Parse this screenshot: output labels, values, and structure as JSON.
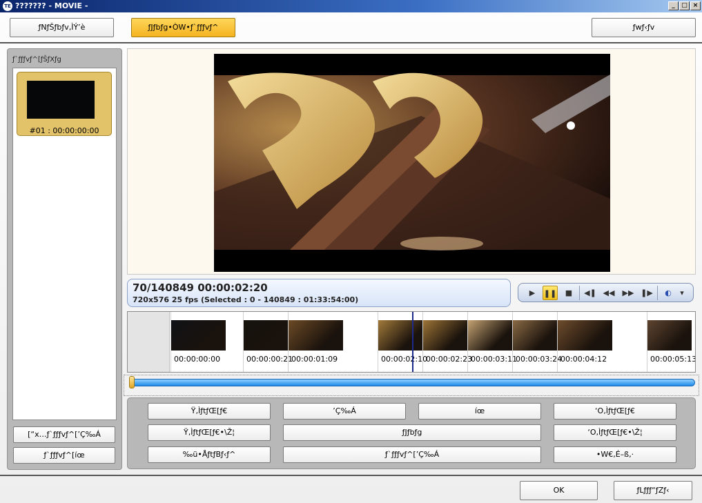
{
  "window": {
    "title": "??????? - MOVIE -",
    "min_label": "_",
    "max_label": "□",
    "close_label": "×"
  },
  "toolbar": {
    "left_button": "ƒNƒŠƒbƒv‚ÌÝ’è",
    "middle_button": "ƒJƒbƒg•ÒW•ƒ`ƒƒƒvƒ^",
    "right_button": "ƒwƒ‹ƒv"
  },
  "chapter_panel": {
    "label": "ƒ`ƒƒƒvƒ^[ƒŠƒXƒg",
    "items": [
      {
        "label": "#01 : 00:00:00:00"
      }
    ],
    "add_button": "[“x…ƒ`ƒƒƒvƒ^[’Ç‰Á",
    "delete_button": "ƒ`ƒƒƒvƒ^[íœ"
  },
  "player": {
    "position_text": "70/140849  00:00:02:20",
    "detail_text": "720x576 25 fps  (Selected : 0 - 140849 : 01:33:54:00)",
    "progress_fraction": 0.0005,
    "controls": [
      "play-icon",
      "pause-icon",
      "stop-icon",
      "step-back-icon",
      "rewind-icon",
      "fast-forward-icon",
      "step-forward-icon",
      "audio-icon",
      "dropdown-icon"
    ],
    "control_glyphs": {
      "play": "▶",
      "pause": "❚❚",
      "stop": "■",
      "step_back": "◀❚",
      "rewind": "◀◀",
      "fast_forward": "▶▶",
      "step_forward": "❚▶",
      "audio": "◐",
      "dropdown": "▾"
    }
  },
  "timeline": {
    "frames": [
      {
        "time": "00:00:00:00",
        "tone": "#101216"
      },
      {
        "time": "00:00:00:21",
        "tone": "#15120e"
      },
      {
        "time": "00:00:01:09",
        "tone": "#6b4a26"
      },
      {
        "time": "00:00:02:10",
        "tone": "#a27a3a"
      },
      {
        "time": "00:00:02:23",
        "tone": "#9d7436"
      },
      {
        "time": "00:00:03:11",
        "tone": "#c4a272"
      },
      {
        "time": "00:00:03:24",
        "tone": "#8a6a44"
      },
      {
        "time": "00:00:04:12",
        "tone": "#6d4c2c"
      },
      {
        "time": "00:00:05:13",
        "tone": "#5e4430"
      }
    ]
  },
  "commands": {
    "row1": [
      "Ÿ‚ÌƒtƒŒ[ƒ€",
      "’Ç‰Á",
      "íœ",
      "‘O‚ÌƒtƒŒ[ƒ€"
    ],
    "row2": [
      "Ÿ‚ÌƒtƒŒ[ƒ€•\\Ž¦",
      "ƒJƒbƒg",
      "‘O‚ÌƒtƒŒ[ƒ€•\\Ž¦"
    ],
    "row3": [
      "‰ü•ÅƒtƒBƒ‹ƒ^",
      "ƒ`ƒƒƒvƒ^[’Ç‰Á",
      "•W€‚É–ß‚·"
    ]
  },
  "footer": {
    "ok_button": "OK",
    "cancel_button": "ƒLƒƒƒ“ƒZƒ‹"
  }
}
